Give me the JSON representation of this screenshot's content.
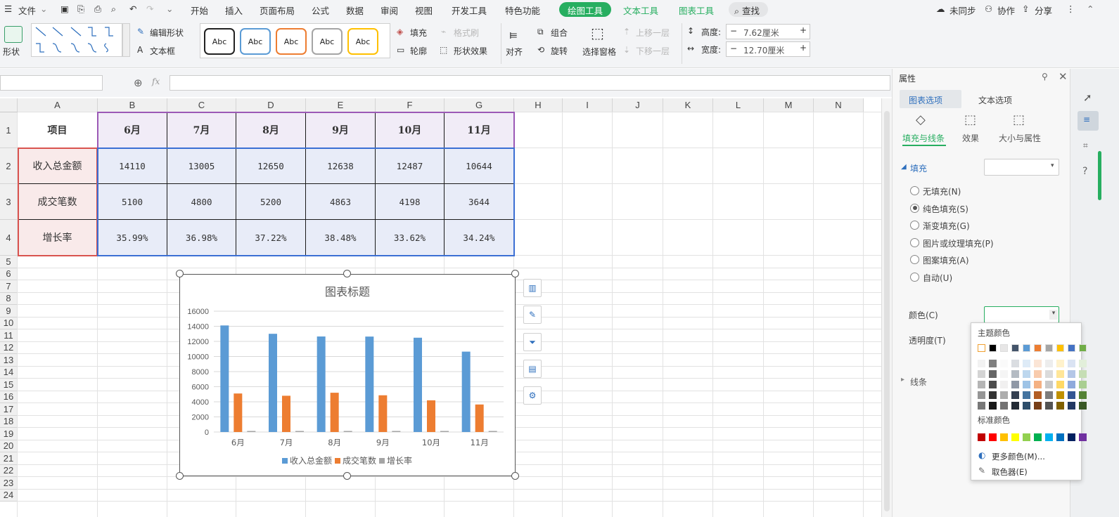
{
  "menubar": {
    "file": "文件",
    "items": [
      "开始",
      "插入",
      "页面布局",
      "公式",
      "数据",
      "审阅",
      "视图",
      "开发工具",
      "特色功能"
    ],
    "tool_tabs": [
      "绘图工具",
      "文本工具",
      "图表工具"
    ],
    "search": "查找",
    "right": [
      "未同步",
      "协作",
      "分享"
    ]
  },
  "ribbon": {
    "shape": "形状",
    "edit_shape": "编辑形状",
    "textbox": "文本框",
    "style_boxes": [
      "Abc",
      "Abc",
      "Abc",
      "Abc",
      "Abc"
    ],
    "fill": "填充",
    "format_brush": "格式刷",
    "outline": "轮廓",
    "shape_effect": "形状效果",
    "align": "对齐",
    "group": "组合",
    "rotate": "旋转",
    "selection_pane": "选择窗格",
    "bring_forward": "上移一层",
    "send_backward": "下移一层",
    "height_label": "高度:",
    "height_value": "7.62厘米",
    "width_label": "宽度:",
    "width_value": "12.70厘米",
    "minus": "−",
    "plus": "+"
  },
  "formula": {
    "fx": "fx"
  },
  "grid": {
    "columns": [
      "A",
      "B",
      "C",
      "D",
      "E",
      "F",
      "G",
      "H",
      "I",
      "J",
      "K",
      "L",
      "M",
      "N"
    ],
    "rows": [
      "1",
      "2",
      "3",
      "4",
      "5",
      "6",
      "7",
      "8",
      "9",
      "10",
      "11",
      "12",
      "13",
      "14",
      "15",
      "16",
      "17",
      "18",
      "19",
      "20",
      "21",
      "22",
      "23",
      "24"
    ],
    "table": {
      "header": [
        "项目",
        "6月",
        "7月",
        "8月",
        "9月",
        "10月",
        "11月"
      ],
      "rows": [
        [
          "收入总金额",
          "14110",
          "13005",
          "12650",
          "12638",
          "12487",
          "10644"
        ],
        [
          "成交笔数",
          "5100",
          "4800",
          "5200",
          "4863",
          "4198",
          "3644"
        ],
        [
          "增长率",
          "35.99%",
          "36.98%",
          "37.22%",
          "38.48%",
          "33.62%",
          "34.24%"
        ]
      ]
    }
  },
  "chart_data": {
    "type": "bar",
    "title": "图表标题",
    "categories": [
      "6月",
      "7月",
      "8月",
      "9月",
      "10月",
      "11月"
    ],
    "series": [
      {
        "name": "收入总金额",
        "values": [
          14110,
          13005,
          12650,
          12638,
          12487,
          10644
        ],
        "color": "#5b9bd5"
      },
      {
        "name": "成交笔数",
        "values": [
          5100,
          4800,
          5200,
          4863,
          4198,
          3644
        ],
        "color": "#ed7d31"
      },
      {
        "name": "增长率",
        "values": [
          0.3599,
          0.3698,
          0.3722,
          0.3848,
          0.3362,
          0.3424
        ],
        "color": "#a5a5a5"
      }
    ],
    "ylim": [
      0,
      16000
    ],
    "yticks": [
      "16000",
      "14000",
      "12000",
      "10000",
      "8000",
      "6000",
      "4000",
      "2000",
      "0"
    ],
    "legend": "bottom",
    "grid": true
  },
  "panel": {
    "title": "属性",
    "tab_chart": "图表选项",
    "tab_text": "文本选项",
    "sub_fill": "填充与线条",
    "sub_effect": "效果",
    "sub_size": "大小与属性",
    "fill_section": "填充",
    "options": [
      "无填充(N)",
      "纯色填充(S)",
      "渐变填充(G)",
      "图片或纹理填充(P)",
      "图案填充(A)",
      "自动(U)"
    ],
    "selected_option": 1,
    "color_label": "颜色(C)",
    "transparency_label": "透明度(T)",
    "line_section": "线条"
  },
  "palette": {
    "theme_title": "主题颜色",
    "standard_title": "标准颜色",
    "more": "更多颜色(M)...",
    "cancel": "取色器(E)",
    "theme_top": [
      "#ffffff",
      "#000000",
      "#e7e6e6",
      "#44546a",
      "#5b9bd5",
      "#ed7d31",
      "#a5a5a5",
      "#ffc000",
      "#4472c4",
      "#70ad47"
    ],
    "standard": [
      "#c00000",
      "#ff0000",
      "#ffc000",
      "#ffff00",
      "#92d050",
      "#00b050",
      "#00b0f0",
      "#0070c0",
      "#002060",
      "#7030a0"
    ]
  }
}
